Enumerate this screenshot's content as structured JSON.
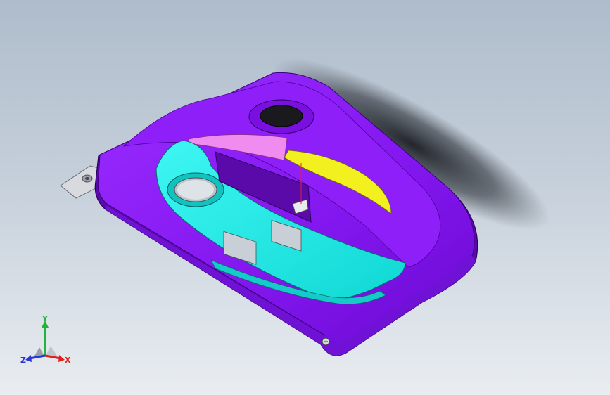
{
  "triad": {
    "x_label": "X",
    "y_label": "Y",
    "z_label": "Z",
    "x_color": "#e0201c",
    "y_color": "#22b33a",
    "z_color": "#2a36d8"
  },
  "part_colors": {
    "panel": "#8a1cf2",
    "panel_dark": "#5a0aa8",
    "panel_light": "#a946ff",
    "armrest": "#1ff2ee",
    "handle_highlight": "#f2f01f",
    "pull_strip": "#f08cf0",
    "bracket": "#d8dadf"
  },
  "background": {
    "top": "#aebccb",
    "bottom": "#e9edf1"
  }
}
